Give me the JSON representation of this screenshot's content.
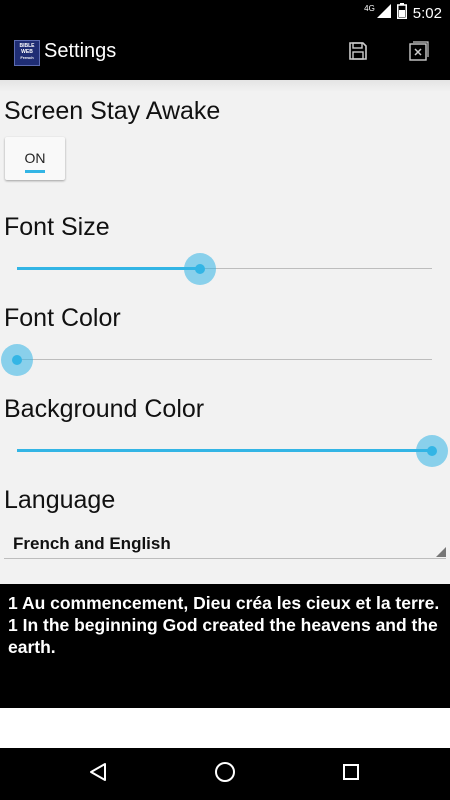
{
  "status_bar": {
    "network": "4G",
    "time": "5:02"
  },
  "app_bar": {
    "logo_lines": [
      "BIBLE",
      "WEB",
      "French"
    ],
    "title": "Settings"
  },
  "settings": {
    "screen_stay_awake": {
      "label": "Screen Stay Awake",
      "toggle_value": "ON"
    },
    "font_size": {
      "label": "Font Size",
      "value_fraction": 0.44
    },
    "font_color": {
      "label": "Font Color",
      "value_fraction": 0.0
    },
    "background_color": {
      "label": "Background Color",
      "value_fraction": 1.0
    },
    "language": {
      "label": "Language",
      "selected": "French and English"
    },
    "accent_color": "#33b5e5"
  },
  "preview": {
    "line1": "1 Au commencement, Dieu créa les cieux et la terre.",
    "line2": "1 In the beginning God created the heavens and the earth."
  },
  "icons": [
    "signal-icon",
    "battery-icon",
    "save-icon",
    "close-icon",
    "back-icon",
    "home-icon",
    "recents-icon"
  ]
}
